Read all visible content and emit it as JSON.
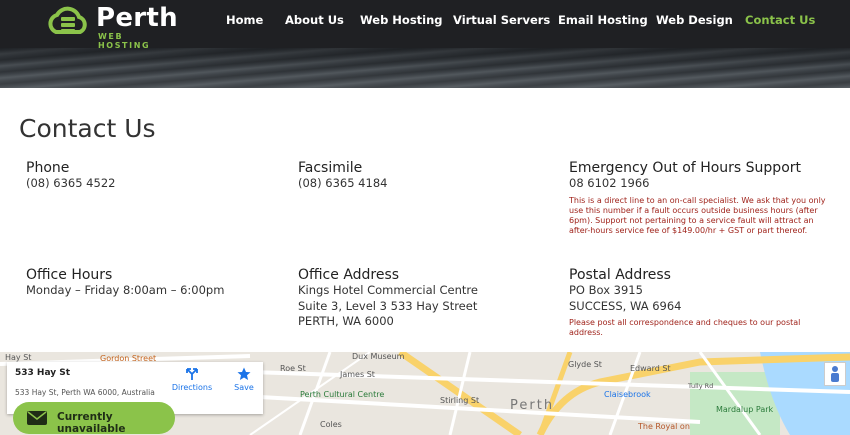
{
  "brand": {
    "name": "Perth",
    "tagline": "WEB HOSTING"
  },
  "nav": [
    {
      "label": "Home"
    },
    {
      "label": "About Us"
    },
    {
      "label": "Web Hosting"
    },
    {
      "label": "Virtual Servers"
    },
    {
      "label": "Email Hosting"
    },
    {
      "label": "Web Design"
    },
    {
      "label": "Contact Us",
      "active": true
    }
  ],
  "page": {
    "title": "Contact Us"
  },
  "contact": {
    "phone": {
      "heading": "Phone",
      "value": "(08) 6365 4522"
    },
    "fax": {
      "heading": "Facsimile",
      "value": "(08) 6365 4184"
    },
    "emergency": {
      "heading": "Emergency Out of Hours Support",
      "value": "08 6102 1966",
      "note": "This is a direct line to an on-call specialist. We ask that you only use this number if a fault occurs outside business hours (after 6pm). Support not pertaining to a service fault will attract an after-hours service fee of $149.00/hr + GST or part thereof."
    },
    "hours": {
      "heading": "Office Hours",
      "value": "Monday – Friday 8:00am – 6:00pm"
    },
    "office": {
      "heading": "Office Address",
      "lines": [
        "Kings Hotel Commercial Centre",
        "Suite 3, Level 3 533 Hay Street",
        "PERTH, WA 6000"
      ]
    },
    "postal": {
      "heading": "Postal Address",
      "lines": [
        "PO Box 3915",
        "SUCCESS, WA 6964"
      ],
      "note": "Please post all correspondence and cheques to our postal address."
    }
  },
  "map": {
    "place_title": "533 Hay St",
    "place_address": "533 Hay St, Perth WA 6000, Australia",
    "directions_label": "Directions",
    "save_label": "Save",
    "status_label": "Currently unavailable",
    "labels": [
      "Gordon Street",
      "Dux Museum",
      "Roe St",
      "James St",
      "Perth Cultural Centre",
      "Coles",
      "Perth",
      "Stirling St",
      "Claisebrook",
      "Tully Rd",
      "Mardalup Park",
      "The Royal on",
      "Edward St",
      "Glyde St",
      "Hay St"
    ],
    "colors": {
      "water": "#aadaff",
      "park": "#c5e8c5",
      "road": "#ffffff",
      "highway": "#f9d26a"
    }
  }
}
